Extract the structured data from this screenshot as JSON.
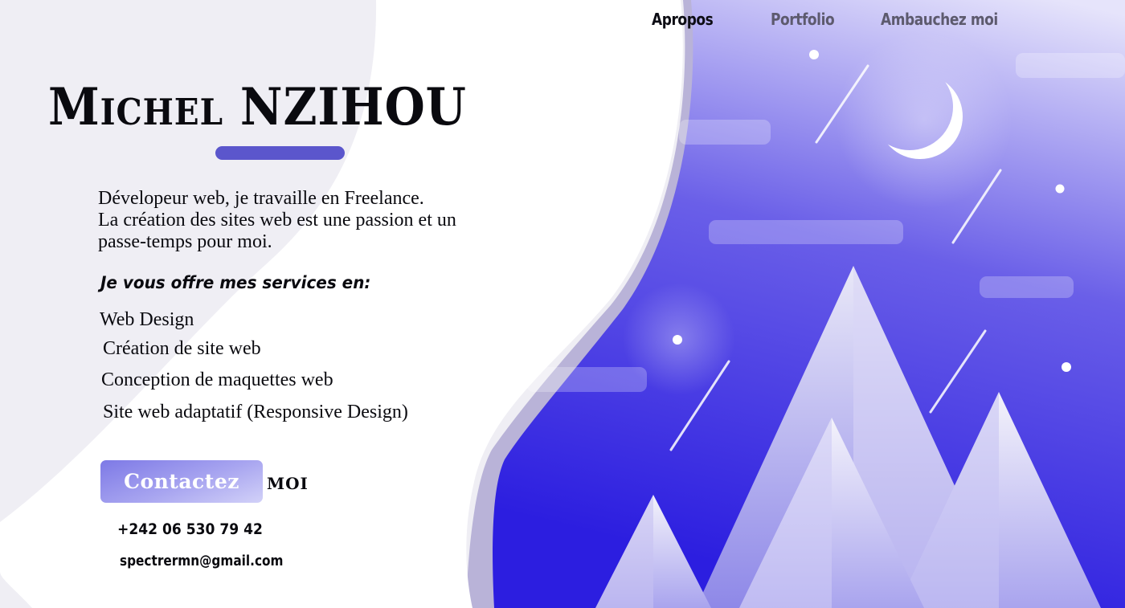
{
  "nav": {
    "items": [
      {
        "label": "Apropos",
        "active": true
      },
      {
        "label": "Portfolio",
        "active": false
      },
      {
        "label": "Ambauchez moi",
        "active": false
      }
    ]
  },
  "hero": {
    "name": "Michel  NZIHOU",
    "intro_lines": [
      "Dévelopeur web, je travaille en Freelance.",
      "La création des sites web est une passion et un",
      "passe-temps pour moi."
    ],
    "services_title": "Je vous offre mes services en:",
    "services": [
      "Web Design",
      "Création de site web",
      "Conception de maquettes web",
      "Site web adaptatif (Responsive Design)"
    ]
  },
  "contact": {
    "button_label": "Contactez",
    "suffix": "MOI",
    "phone": "+242 06 530 79 42",
    "email": "spectrermn@gmail.com"
  },
  "colors": {
    "accent": "#5b56cc",
    "sky_top": "#c9c6f4",
    "sky_bottom": "#2c1ee0",
    "page_bg": "#efeef4"
  },
  "illustration": {
    "icons": [
      "moon-icon",
      "star-icon",
      "shooting-star-icon",
      "cloud-icon",
      "mountain-icon"
    ]
  }
}
